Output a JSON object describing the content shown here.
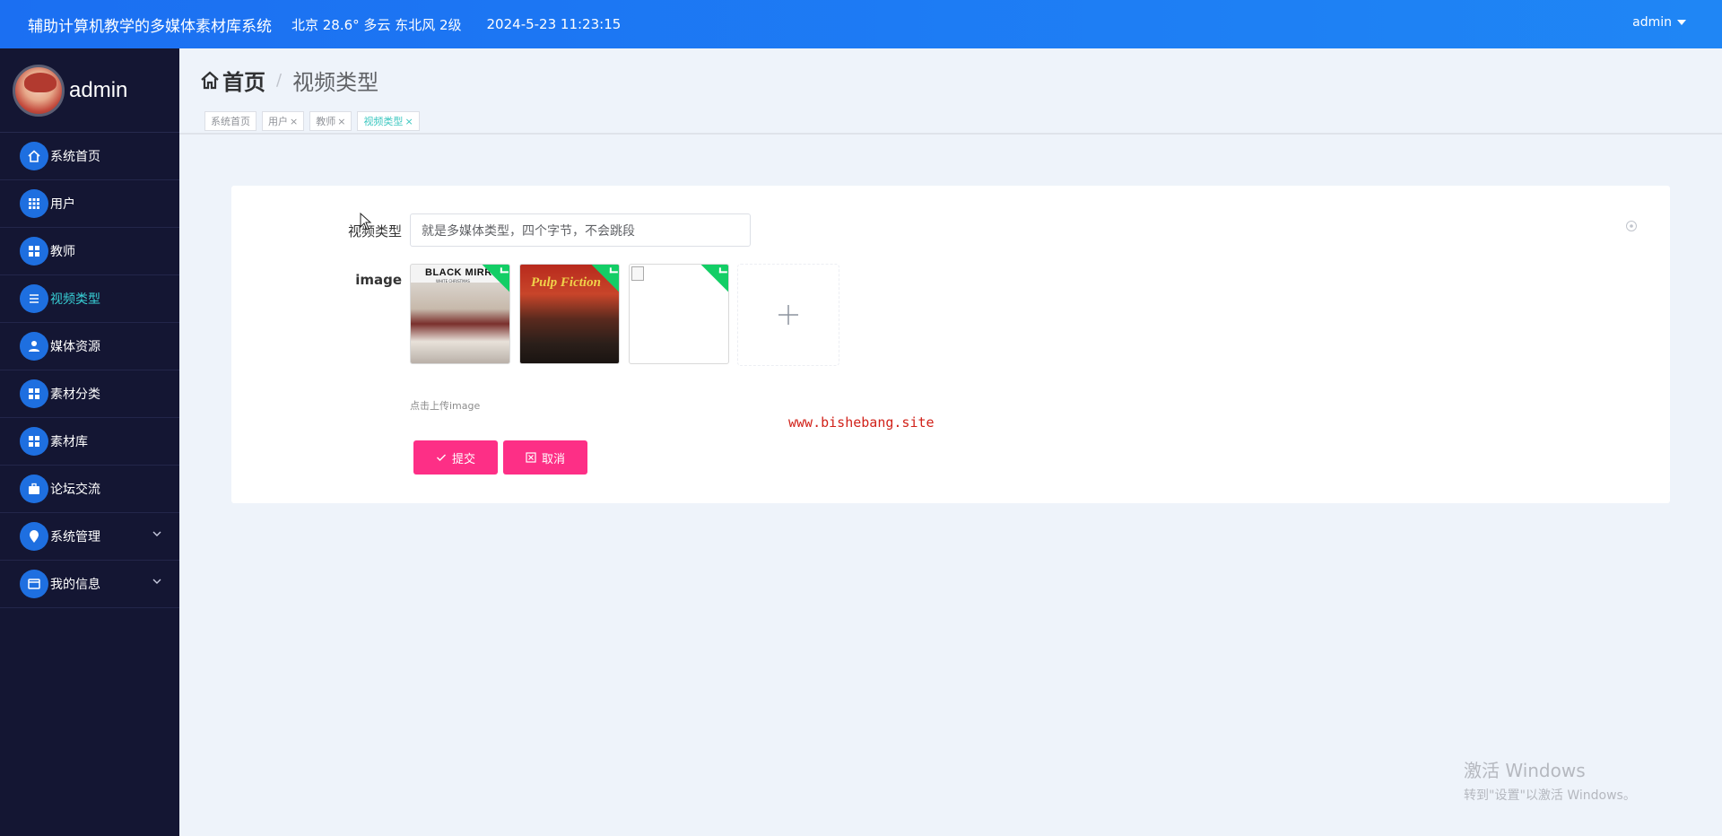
{
  "topbar": {
    "app_title": "辅助计算机教学的多媒体素材库系统",
    "weather": "北京  28.6°  多云  东北风  2级",
    "datetime": "2024-5-23 11:23:15",
    "user": "admin"
  },
  "sidebar": {
    "profile_name": "admin",
    "items": [
      {
        "label": "系统首页",
        "icon": "home-icon"
      },
      {
        "label": "用户",
        "icon": "grid-icon"
      },
      {
        "label": "教师",
        "icon": "grid-icon"
      },
      {
        "label": "视频类型",
        "icon": "list-icon",
        "active": true
      },
      {
        "label": "媒体资源",
        "icon": "person-icon"
      },
      {
        "label": "素材分类",
        "icon": "grid-icon"
      },
      {
        "label": "素材库",
        "icon": "grid-icon"
      },
      {
        "label": "论坛交流",
        "icon": "briefcase-icon"
      },
      {
        "label": "系统管理",
        "icon": "pin-icon",
        "expandable": true
      },
      {
        "label": "我的信息",
        "icon": "window-icon",
        "expandable": true
      }
    ]
  },
  "breadcrumb": {
    "home": "首页",
    "separator": "/",
    "current": "视频类型"
  },
  "tabs": [
    {
      "label": "系统首页",
      "closable": false
    },
    {
      "label": "用户",
      "closable": true
    },
    {
      "label": "教师",
      "closable": true
    },
    {
      "label": "视频类型",
      "closable": true,
      "active": true
    }
  ],
  "form": {
    "type_label": "视频类型",
    "type_value": "就是多媒体类型，四个字节，不会跳段",
    "image_label": "image",
    "images": [
      {
        "title": "BLACK MIRROR",
        "subtitle": "WHITE CHRISTMAS"
      },
      {
        "title": "Pulp Fiction",
        "subtitle": ""
      },
      {
        "title": "",
        "subtitle": ""
      }
    ],
    "upload_tip": "点击上传image",
    "submit_label": "提交",
    "cancel_label": "取消"
  },
  "watermark_url": "www.bishebang.site",
  "windows_activation": {
    "title": "激活 Windows",
    "subtitle": "转到\"设置\"以激活 Windows。"
  },
  "colors": {
    "topbar": "#1b6ff2",
    "sidebar": "#141633",
    "active_nav": "#38d0d6",
    "button": "#fd2f86",
    "badge": "#13ce66"
  }
}
